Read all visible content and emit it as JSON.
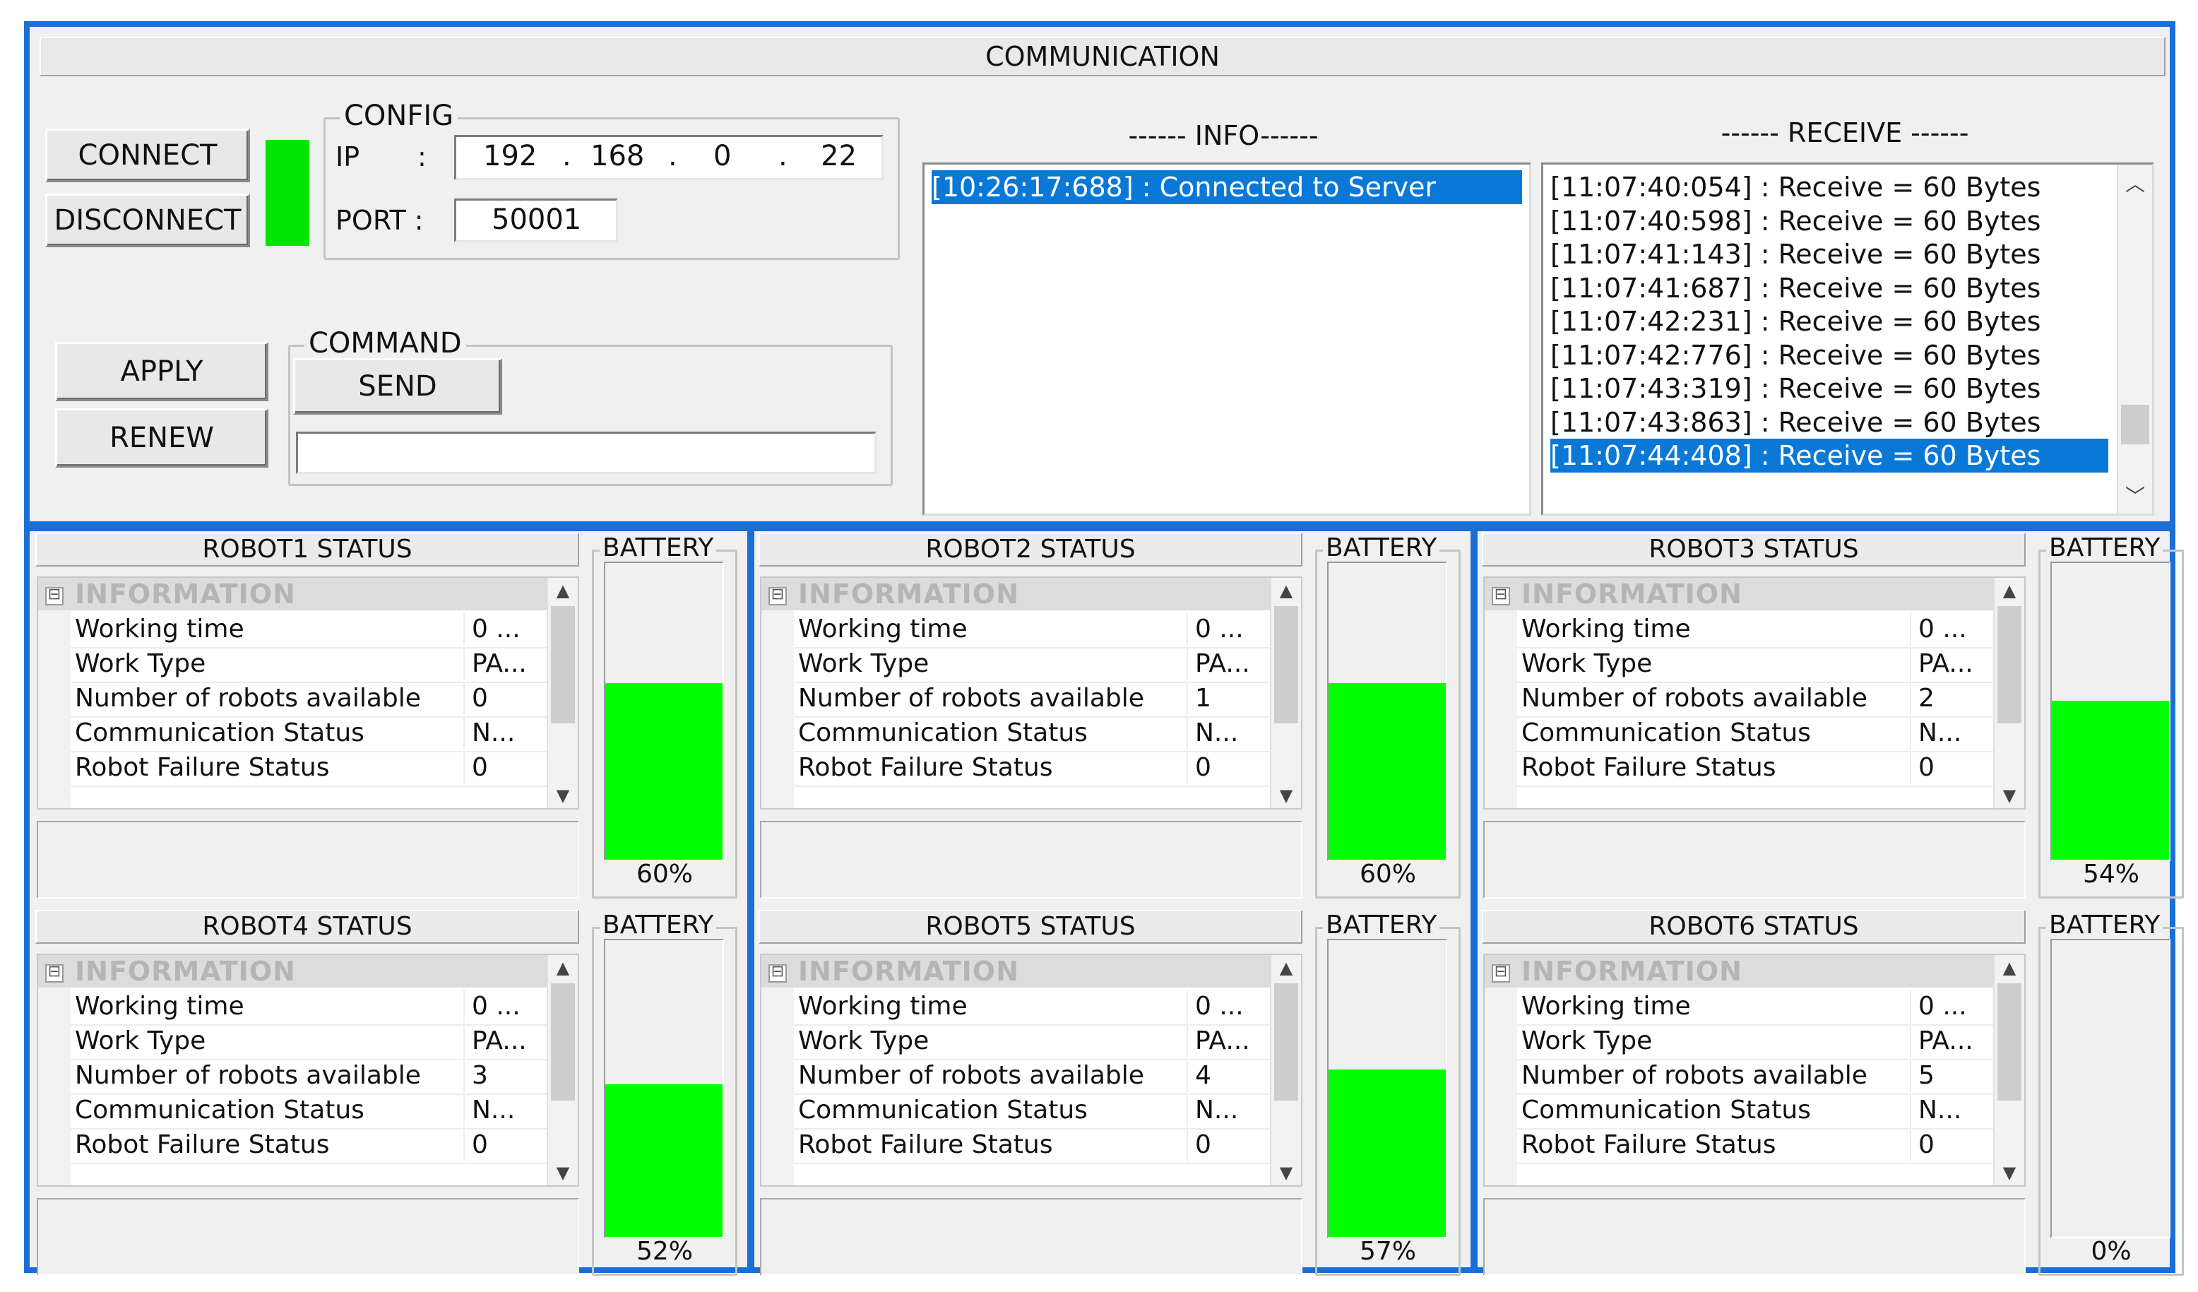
{
  "header": {
    "title": "COMMUNICATION"
  },
  "connection": {
    "connect_label": "CONNECT",
    "disconnect_label": "DISCONNECT",
    "status_color": "#00e600"
  },
  "config": {
    "group_label": "CONFIG",
    "ip_label": "IP",
    "ip_colon": ":",
    "ip_octets": [
      "192",
      "168",
      "0",
      "22"
    ],
    "port_label": "PORT :",
    "port_value": "50001"
  },
  "command": {
    "apply_label": "APPLY",
    "renew_label": "RENEW",
    "group_label": "COMMAND",
    "send_label": "SEND",
    "input_value": ""
  },
  "info": {
    "title": "------ INFO------",
    "lines": [
      "[10:26:17:688] : Connected to Server"
    ],
    "selected_index": 0
  },
  "receive": {
    "title": "------ RECEIVE ------",
    "lines": [
      "[11:07:40:054] : Receive = 60 Bytes",
      "[11:07:40:598] : Receive = 60 Bytes",
      "[11:07:41:143] : Receive = 60 Bytes",
      "[11:07:41:687] : Receive = 60 Bytes",
      "[11:07:42:231] : Receive = 60 Bytes",
      "[11:07:42:776] : Receive = 60 Bytes",
      "[11:07:43:319] : Receive = 60 Bytes",
      "[11:07:43:863] : Receive = 60 Bytes",
      "[11:07:44:408] : Receive = 60 Bytes"
    ],
    "selected_index": 8,
    "scroll_up_icon": "chevron-up-icon",
    "scroll_down_icon": "chevron-down-icon"
  },
  "robot_common": {
    "category_label": "INFORMATION",
    "collapse_symbol": "⊟",
    "battery_label": "BATTERY",
    "battery_color": "#00ff00",
    "row_labels": [
      "Working time",
      "Work Type",
      "Number of robots available",
      "Communication Status",
      "Robot Failure Status"
    ]
  },
  "robots": [
    {
      "title": "ROBOT1  STATUS",
      "values": [
        "0 ...",
        "PA...",
        "0",
        "N...",
        "0"
      ],
      "battery_percent": 60,
      "battery_text": "60%"
    },
    {
      "title": "ROBOT2  STATUS",
      "values": [
        "0 ...",
        "PA...",
        "1",
        "N...",
        "0"
      ],
      "battery_percent": 60,
      "battery_text": "60%"
    },
    {
      "title": "ROBOT3  STATUS",
      "values": [
        "0 ...",
        "PA...",
        "2",
        "N...",
        "0"
      ],
      "battery_percent": 54,
      "battery_text": "54%"
    },
    {
      "title": "ROBOT4  STATUS",
      "values": [
        "0 ...",
        "PA...",
        "3",
        "N...",
        "0"
      ],
      "battery_percent": 52,
      "battery_text": "52%"
    },
    {
      "title": "ROBOT5  STATUS",
      "values": [
        "0 ...",
        "PA...",
        "4",
        "N...",
        "0"
      ],
      "battery_percent": 57,
      "battery_text": "57%"
    },
    {
      "title": "ROBOT6  STATUS",
      "values": [
        "0 ...",
        "PA...",
        "5",
        "N...",
        "0"
      ],
      "battery_percent": 0,
      "battery_text": "0%"
    }
  ]
}
